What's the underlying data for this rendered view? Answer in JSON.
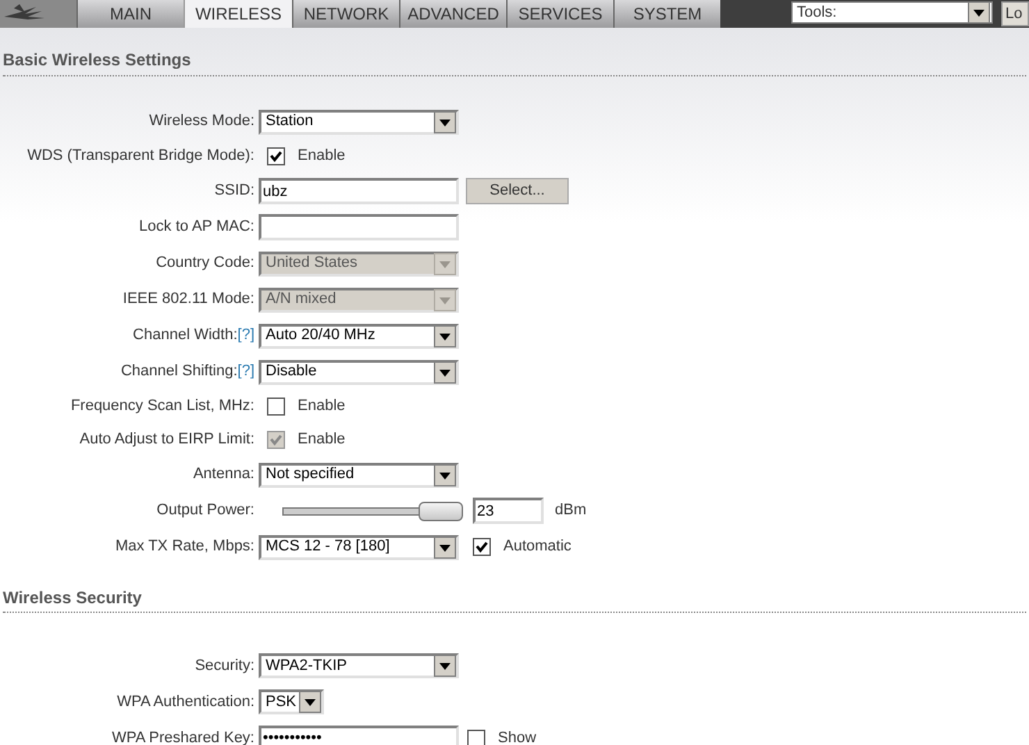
{
  "header": {
    "tabs": [
      {
        "label": "MAIN",
        "selected": false
      },
      {
        "label": "WIRELESS",
        "selected": true
      },
      {
        "label": "NETWORK",
        "selected": false
      },
      {
        "label": "ADVANCED",
        "selected": false
      },
      {
        "label": "SERVICES",
        "selected": false
      },
      {
        "label": "SYSTEM",
        "selected": false
      }
    ],
    "tools": {
      "value": "Tools:"
    },
    "logout_button": "Lo"
  },
  "sections": [
    {
      "title": "Basic Wireless Settings",
      "rows": [
        {
          "kind": "select",
          "label": "Wireless Mode:",
          "value": "Station",
          "disabled": false
        },
        {
          "kind": "checkbox",
          "label": "WDS (Transparent Bridge Mode):",
          "checked": true,
          "disabled": false,
          "option": "Enable"
        },
        {
          "kind": "text",
          "label": "SSID:",
          "value": "ubz",
          "button": "Select..."
        },
        {
          "kind": "text",
          "label": "Lock to AP MAC:"
        },
        {
          "kind": "select",
          "label": "Country Code:",
          "value": "United States",
          "disabled": true
        },
        {
          "kind": "select",
          "label": "IEEE 802.11 Mode:",
          "value": "A/N mixed",
          "disabled": true
        },
        {
          "kind": "select",
          "label": "Channel Width:",
          "help": "[?]",
          "value": "Auto 20/40 MHz",
          "disabled": false
        },
        {
          "kind": "select",
          "label": "Channel Shifting:",
          "help": "[?]",
          "value": "Disable",
          "disabled": false
        },
        {
          "kind": "checkbox",
          "label": "Frequency Scan List, MHz:",
          "checked": false,
          "disabled": false,
          "option": "Enable"
        },
        {
          "kind": "checkbox",
          "label": "Auto Adjust to EIRP Limit:",
          "checked": true,
          "disabled": true,
          "option": "Enable"
        },
        {
          "kind": "select",
          "label": "Antenna:",
          "value": "Not specified",
          "disabled": false
        },
        {
          "kind": "slider",
          "label": "Output Power:",
          "level": 1.0,
          "value": "23",
          "unit": "dBm"
        },
        {
          "kind": "select",
          "label": "Max TX Rate, Mbps:",
          "value": "MCS 12 - 78 [180]",
          "disabled": false,
          "checked": true,
          "option": "Automatic"
        }
      ]
    },
    {
      "title": "Wireless Security",
      "rows": [
        {
          "kind": "select",
          "label": "Security:",
          "value": "WPA2-TKIP",
          "disabled": false
        },
        {
          "kind": "small-select",
          "label": "WPA Authentication:",
          "value": "PSK",
          "disabled": false
        },
        {
          "kind": "text",
          "label": "WPA Preshared Key:",
          "value": "•••••••••••",
          "checked": false,
          "option": "Show"
        }
      ]
    }
  ]
}
